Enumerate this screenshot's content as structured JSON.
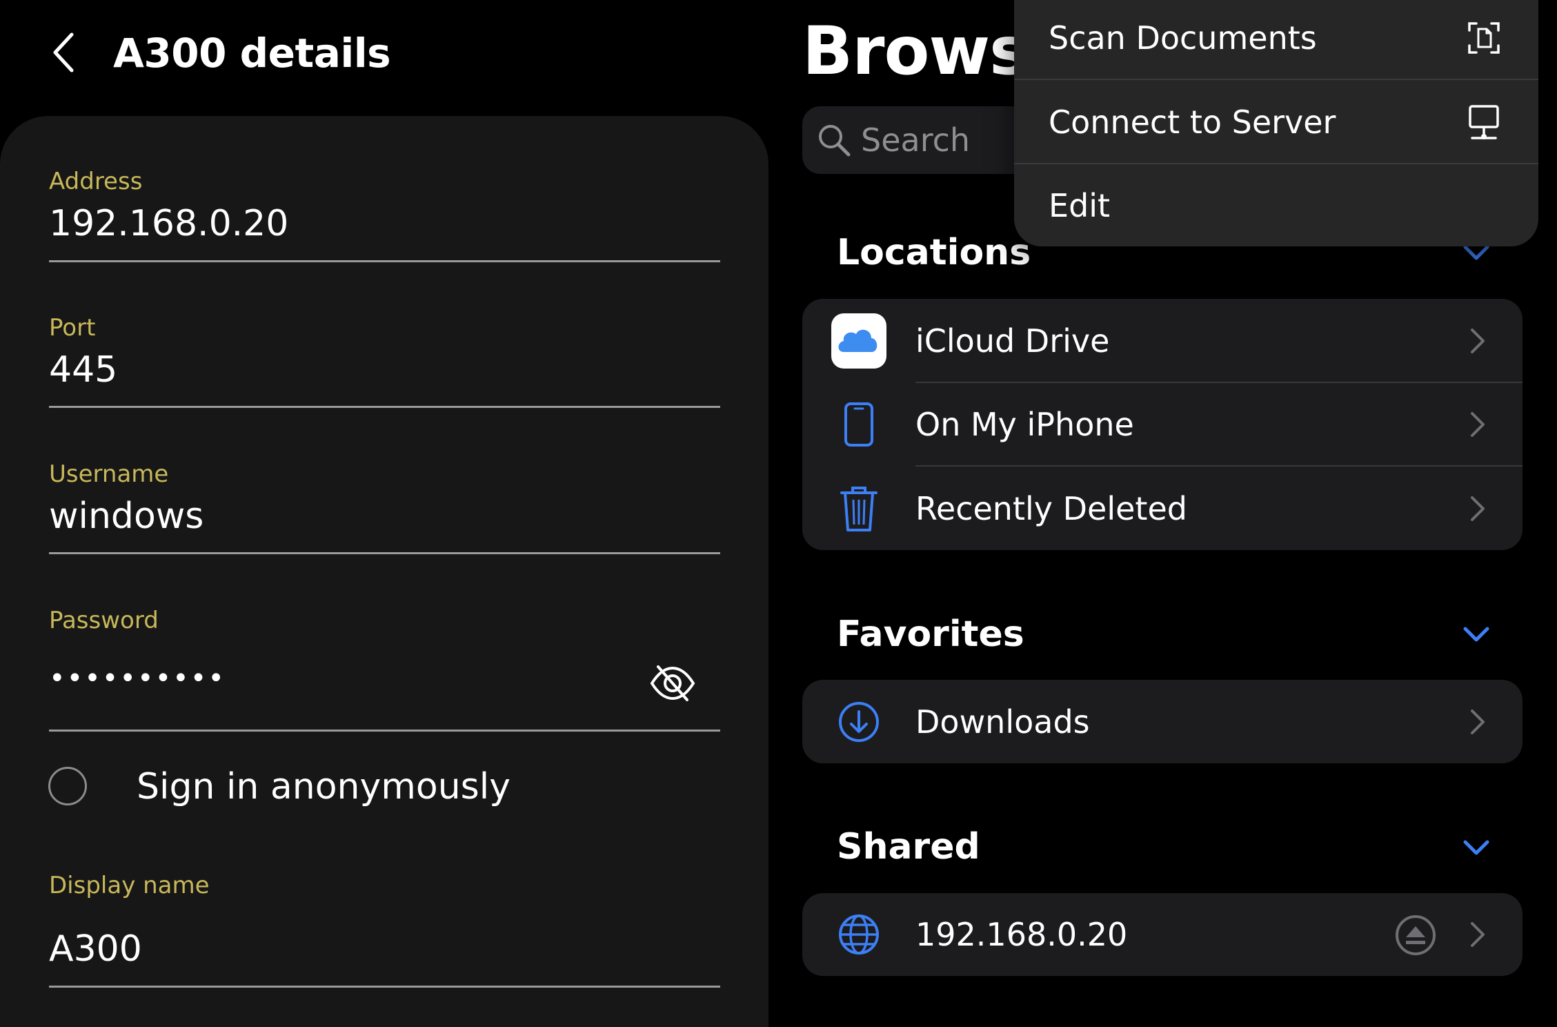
{
  "left_panel": {
    "title": "A300 details",
    "fields": {
      "address": {
        "label": "Address",
        "value": "192.168.0.20"
      },
      "port": {
        "label": "Port",
        "value": "445"
      },
      "username": {
        "label": "Username",
        "value": "windows"
      },
      "password": {
        "label": "Password",
        "value": "••••••••••"
      },
      "display_name": {
        "label": "Display name",
        "value": "A300"
      }
    },
    "anonymous_option": {
      "label": "Sign in anonymously",
      "checked": false
    }
  },
  "right_panel": {
    "title": "Browse",
    "search": {
      "placeholder": "Search"
    },
    "sections": {
      "locations": {
        "title": "Locations",
        "items": [
          {
            "label": "iCloud Drive",
            "icon": "icloud-icon"
          },
          {
            "label": "On My iPhone",
            "icon": "iphone-icon"
          },
          {
            "label": "Recently Deleted",
            "icon": "trash-icon"
          }
        ]
      },
      "favorites": {
        "title": "Favorites",
        "items": [
          {
            "label": "Downloads",
            "icon": "download-icon"
          }
        ]
      },
      "shared": {
        "title": "Shared",
        "items": [
          {
            "label": "192.168.0.20",
            "icon": "globe-icon"
          }
        ]
      }
    }
  },
  "menu": {
    "items": [
      {
        "label": "Scan Documents",
        "icon": "scan-document-icon"
      },
      {
        "label": "Connect to Server",
        "icon": "server-monitor-icon"
      },
      {
        "label": "Edit"
      }
    ]
  },
  "colors": {
    "field_label": "#c8b85a",
    "accent_blue": "#3d7ff5",
    "card_bg": "#171717",
    "group_bg": "#1c1c1e",
    "menu_bg": "#262626"
  }
}
